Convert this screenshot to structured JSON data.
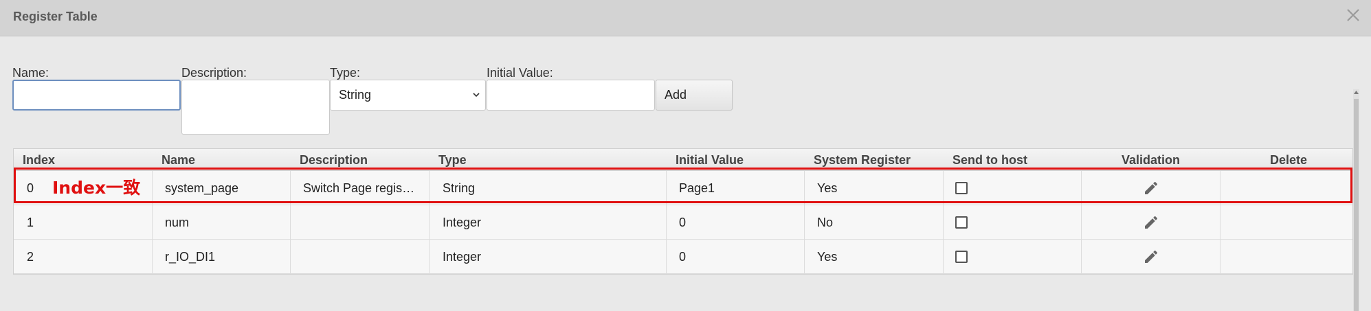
{
  "dialog": {
    "title": "Register Table"
  },
  "form": {
    "name_label": "Name:",
    "name_value": "",
    "description_label": "Description:",
    "description_value": "",
    "type_label": "Type:",
    "type_selected": "String",
    "initial_value_label": "Initial Value:",
    "initial_value_value": "",
    "add_label": "Add"
  },
  "table": {
    "columns": [
      "Index",
      "Name",
      "Description",
      "Type",
      "Initial Value",
      "System Register",
      "Send to host",
      "Validation",
      "Delete"
    ],
    "rows": [
      {
        "index": "0",
        "name": "system_page",
        "description": "Switch Page regis…",
        "type": "String",
        "initial_value": "Page1",
        "system_register": "Yes",
        "send_to_host": false
      },
      {
        "index": "1",
        "name": "num",
        "description": "",
        "type": "Integer",
        "initial_value": "0",
        "system_register": "No",
        "send_to_host": false
      },
      {
        "index": "2",
        "name": "r_IO_DI1",
        "description": "",
        "type": "Integer",
        "initial_value": "0",
        "system_register": "Yes",
        "send_to_host": false
      }
    ]
  },
  "annotation": {
    "text": "Index一致",
    "color": "#e01010"
  },
  "icons": {
    "close": "close-icon",
    "validation": "pencil-icon",
    "dropdown": "chevron-down-icon"
  }
}
